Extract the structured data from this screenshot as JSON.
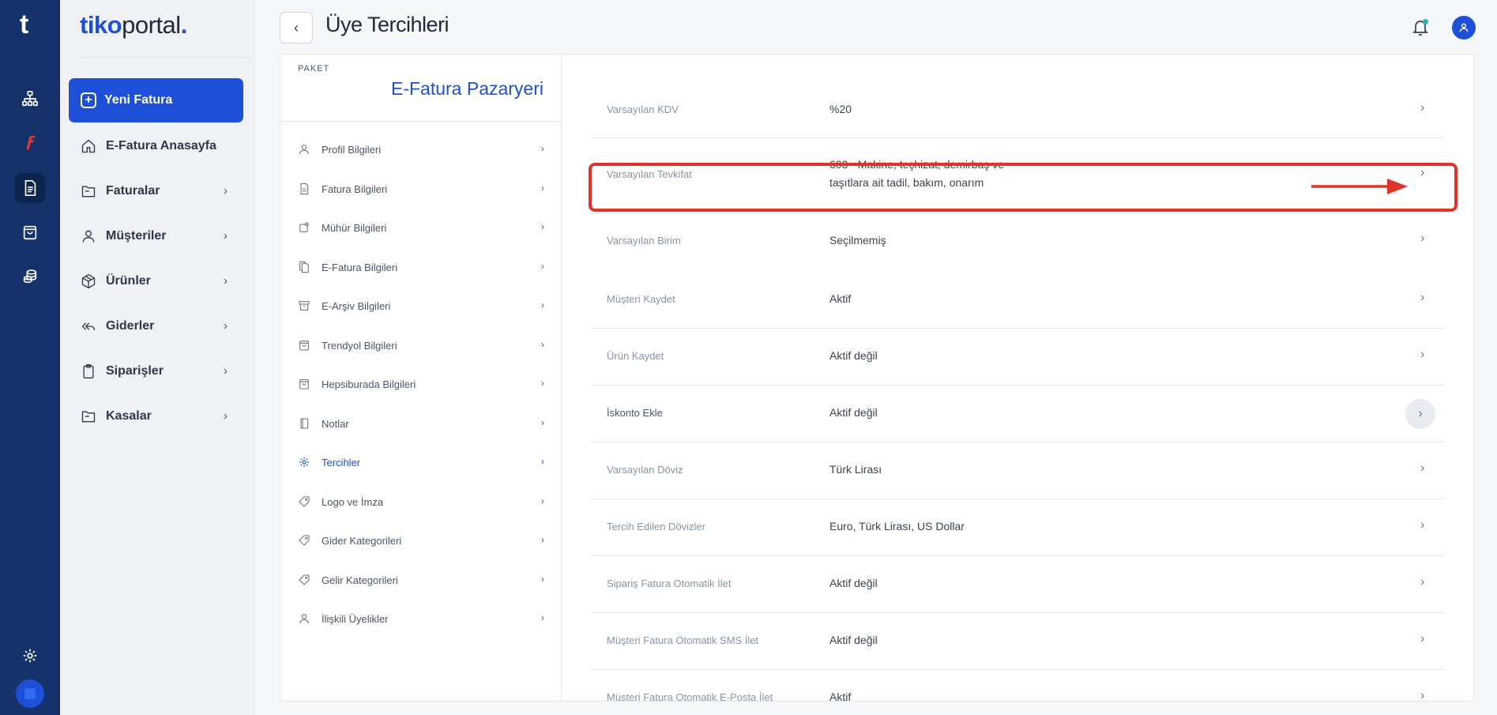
{
  "rail": {
    "logo": "t",
    "icons": [
      "sitemap-icon",
      "e-fatura-icon",
      "document-icon",
      "shopping-bag-icon",
      "coins-icon",
      "settings-icon"
    ]
  },
  "brand": {
    "part1": "tiko",
    "part2": "portal",
    "part3": "."
  },
  "sidebar": {
    "new_invoice": "Yeni Fatura",
    "items": [
      {
        "label": "E-Fatura Anasayfa",
        "icon": "home-icon",
        "chevron": false
      },
      {
        "label": "Faturalar",
        "icon": "folder-icon",
        "chevron": true
      },
      {
        "label": "Müşteriler",
        "icon": "user-icon",
        "chevron": true
      },
      {
        "label": "Ürünler",
        "icon": "box-icon",
        "chevron": true
      },
      {
        "label": "Giderler",
        "icon": "reply-all-icon",
        "chevron": true
      },
      {
        "label": "Siparişler",
        "icon": "clipboard-icon",
        "chevron": true
      },
      {
        "label": "Kasalar",
        "icon": "folder-icon",
        "chevron": true
      }
    ]
  },
  "header": {
    "title": "Üye Tercihleri"
  },
  "package": {
    "label": "PAKET",
    "name": "E-Fatura Pazaryeri"
  },
  "menu": [
    {
      "label": "Profil Bilgileri",
      "icon": "user-icon"
    },
    {
      "label": "Fatura Bilgileri",
      "icon": "document-icon"
    },
    {
      "label": "Mühür Bilgileri",
      "icon": "stamp-icon"
    },
    {
      "label": "E-Fatura Bilgileri",
      "icon": "files-icon"
    },
    {
      "label": "E-Arşiv Bilgileri",
      "icon": "archive-icon"
    },
    {
      "label": "Trendyol Bilgileri",
      "icon": "shopping-bag-icon"
    },
    {
      "label": "Hepsiburada Bilgileri",
      "icon": "shopping-bag-icon"
    },
    {
      "label": "Notlar",
      "icon": "notebook-icon"
    },
    {
      "label": "Tercihler",
      "icon": "gear-icon",
      "active": true
    },
    {
      "label": "Logo ve İmza",
      "icon": "tag-icon"
    },
    {
      "label": "Gider Kategorileri",
      "icon": "tag-icon"
    },
    {
      "label": "Gelir Kategorileri",
      "icon": "tag-icon"
    },
    {
      "label": "İlişkili Üyelikler",
      "icon": "user-icon"
    }
  ],
  "preferences": [
    {
      "label": "Varsayılan KDV",
      "value": "%20"
    },
    {
      "label": "Varsayılan Tevkifat",
      "value": "603 - Makine, teçhizat, demirbaş ve",
      "value2": "taşıtlara ait tadil, bakım, onarım"
    },
    {
      "label": "Varsayılan Birim",
      "value": "Seçilmemiş"
    },
    {
      "label": "Müşteri Kaydet",
      "value": "Aktif"
    },
    {
      "label": "Ürün Kaydet",
      "value": "Aktif değil"
    },
    {
      "label": "İskonto Ekle",
      "value": "Aktif değil"
    },
    {
      "label": "Varsayılan Döviz",
      "value": "Türk Lirası"
    },
    {
      "label": "Tercih Edilen Dövizler",
      "value": "Euro, Türk Lirası, US Dollar"
    },
    {
      "label": "Sipariş Fatura Otomatik İlet",
      "value": "Aktif değil"
    },
    {
      "label": "Müşteri Fatura Otomatik SMS İlet",
      "value": "Aktif değil"
    },
    {
      "label": "Müşteri Fatura Otomatik E-Posta İlet",
      "value": "Aktif"
    }
  ],
  "chevron": "›",
  "colors": {
    "primary": "#1d4fd8",
    "rail": "#15326b",
    "highlight": "#e0342b"
  }
}
